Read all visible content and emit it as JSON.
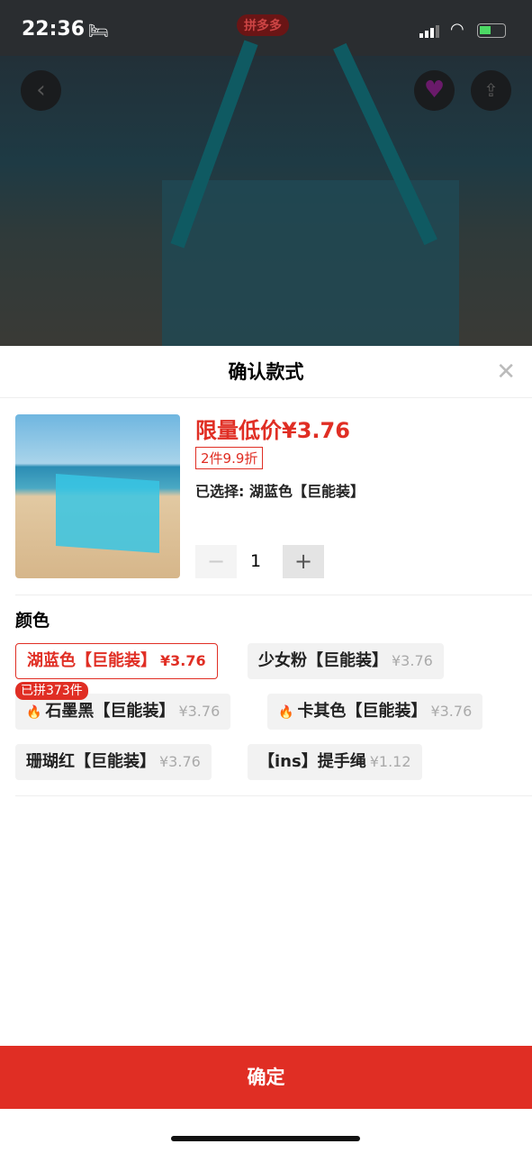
{
  "status": {
    "time": "22:36",
    "carrier_logo": "拼多多"
  },
  "sheet": {
    "title": "确认款式",
    "price": "限量低价¥3.76",
    "promo_tag": "2件9.9折",
    "selected": "已选择: 湖蓝色【巨能装】",
    "quantity": "1",
    "minus": "−",
    "plus": "+",
    "color_label": "颜色",
    "badge": "已拼373件",
    "options": [
      {
        "name": "湖蓝色【巨能装】",
        "price": "¥3.76",
        "selected": true
      },
      {
        "name": "少女粉【巨能装】",
        "price": "¥3.76"
      },
      {
        "name": "石墨黑【巨能装】",
        "price": "¥3.76",
        "hot": true
      },
      {
        "name": "卡其色【巨能装】",
        "price": "¥3.76",
        "hot": true
      },
      {
        "name": "珊瑚红【巨能装】",
        "price": "¥3.76"
      },
      {
        "name": "【ins】提手绳",
        "price": "¥1.12"
      }
    ],
    "confirm": "确定"
  },
  "colors": {
    "accent": "#e02e24"
  }
}
